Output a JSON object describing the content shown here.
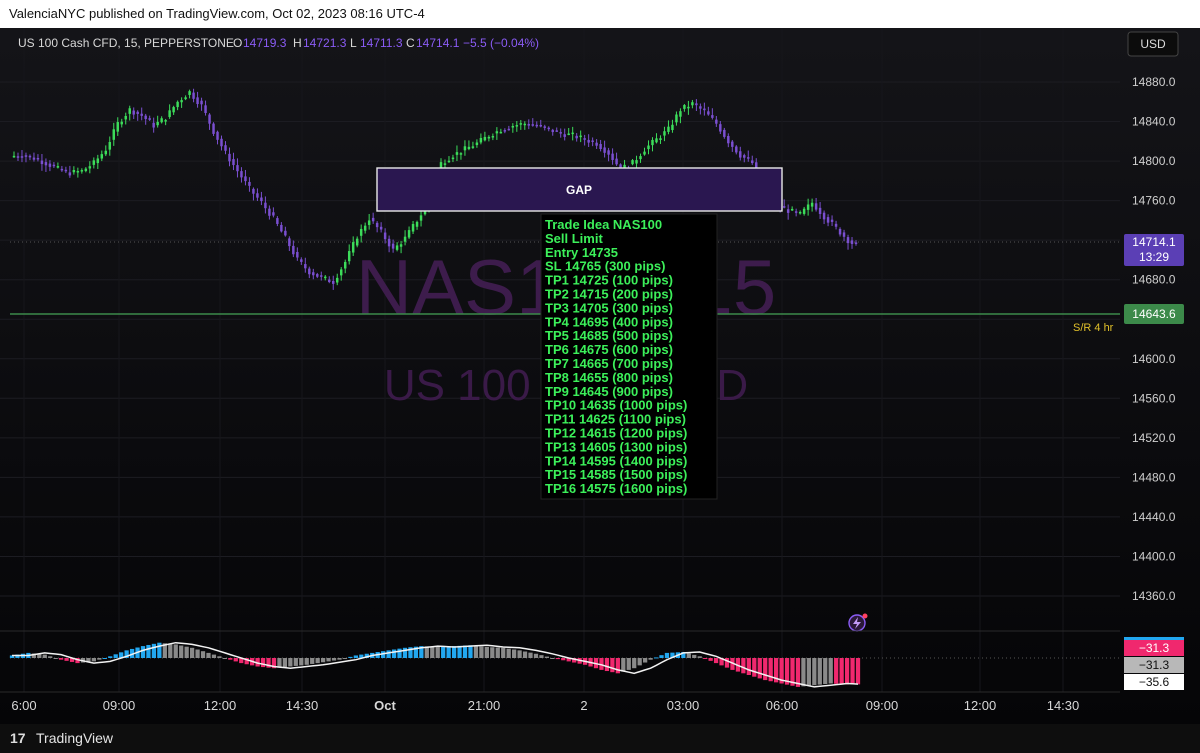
{
  "header": {
    "published": "ValenciaNYC published on TradingView.com, Oct 02, 2023 08:16 UTC-4"
  },
  "footer": {
    "brand": "TradingView",
    "logo": "17"
  },
  "symbol": {
    "name": "US 100 Cash CFD, 15, PEPPERSTONE",
    "o_label": "O",
    "o": "14719.3",
    "h_label": "H",
    "h": "14721.3",
    "l_label": "L",
    "l": "14711.3",
    "c_label": "C",
    "c": "14714.1",
    "change": "−5.5 (−0.04%)"
  },
  "currency": "USD",
  "watermark": {
    "line1": "NAS100, 15",
    "line2": "US 100 Cash CFD"
  },
  "colors": {
    "up": "#3cdc5a",
    "down": "#7a4fd0",
    "hist_blue": "#22a7f0",
    "hist_pink": "#f0286e",
    "hist_grey": "#8a8a8a",
    "sr_line": "#3c8a4a",
    "sr_label": "#e0c02a",
    "text_box": "#3cf05a"
  },
  "gap_label": "GAP",
  "sr": {
    "label": "S/R 4 hr",
    "value": "14643.6"
  },
  "price_tag": {
    "value": "14714.1",
    "timer": "13:29"
  },
  "trade_box": [
    "Trade Idea NAS100",
    "Sell Limit",
    "Entry 14735",
    "SL 14765 (300 pips)",
    "TP1 14725 (100 pips)",
    "TP2 14715 (200 pips)",
    "TP3 14705 (300 pips)",
    "TP4 14695 (400 pips)",
    "TP5 14685 (500 pips)",
    "TP6 14675 (600 pips)",
    "TP7 14665 (700 pips)",
    "TP8 14655 (800 pips)",
    "TP9 14645 (900 pips)",
    "TP10 14635 (1000 pips)",
    "TP11 14625 (1100 pips)",
    "TP12 14615 (1200 pips)",
    "TP13 14605 (1300 pips)",
    "TP14 14595 (1400 pips)",
    "TP15 14585 (1500 pips)",
    "TP16 14575 (1600 pips)"
  ],
  "osc_labels": [
    "−31.3",
    "−31.3",
    "−35.6"
  ],
  "chart_data": {
    "type": "candlestick",
    "y_ticks": [
      14880.0,
      14840.0,
      14800.0,
      14760.0,
      14720.0,
      14680.0,
      14640.0,
      14600.0,
      14560.0,
      14520.0,
      14480.0,
      14440.0,
      14400.0,
      14360.0
    ],
    "hidden_ticks": [
      14720.0,
      14640.0
    ],
    "x_ticks": [
      "6:00",
      "09:00",
      "12:00",
      "14:30",
      "Oct",
      "21:00",
      "2",
      "03:00",
      "06:00",
      "09:00",
      "12:00",
      "14:30"
    ],
    "price_series": [
      [
        0,
        14805
      ],
      [
        3,
        14806
      ],
      [
        6,
        14803
      ],
      [
        9,
        14798
      ],
      [
        12,
        14792
      ],
      [
        15,
        14788
      ],
      [
        18,
        14790
      ],
      [
        21,
        14798
      ],
      [
        24,
        14812
      ],
      [
        27,
        14838
      ],
      [
        30,
        14852
      ],
      [
        33,
        14846
      ],
      [
        36,
        14836
      ],
      [
        39,
        14844
      ],
      [
        42,
        14860
      ],
      [
        45,
        14870
      ],
      [
        48,
        14856
      ],
      [
        51,
        14830
      ],
      [
        54,
        14808
      ],
      [
        57,
        14790
      ],
      [
        60,
        14772
      ],
      [
        63,
        14758
      ],
      [
        66,
        14742
      ],
      [
        69,
        14722
      ],
      [
        72,
        14700
      ],
      [
        75,
        14688
      ],
      [
        78,
        14682
      ],
      [
        81,
        14678
      ],
      [
        84,
        14698
      ],
      [
        87,
        14724
      ],
      [
        90,
        14742
      ],
      [
        93,
        14728
      ],
      [
        96,
        14710
      ],
      [
        99,
        14722
      ],
      [
        102,
        14740
      ],
      [
        105,
        14758
      ],
      [
        108,
        14798
      ],
      [
        111,
        14806
      ],
      [
        114,
        14812
      ],
      [
        117,
        14818
      ],
      [
        120,
        14826
      ],
      [
        123,
        14832
      ],
      [
        126,
        14836
      ],
      [
        129,
        14838
      ],
      [
        132,
        14836
      ],
      [
        135,
        14832
      ],
      [
        138,
        14828
      ],
      [
        141,
        14826
      ],
      [
        144,
        14822
      ],
      [
        147,
        14818
      ],
      [
        150,
        14808
      ],
      [
        153,
        14792
      ],
      [
        156,
        14798
      ],
      [
        159,
        14812
      ],
      [
        162,
        14822
      ],
      [
        165,
        14832
      ],
      [
        168,
        14852
      ],
      [
        171,
        14858
      ],
      [
        174,
        14850
      ],
      [
        177,
        14838
      ],
      [
        180,
        14820
      ],
      [
        183,
        14806
      ],
      [
        186,
        14798
      ],
      [
        189,
        14760
      ],
      [
        192,
        14756
      ],
      [
        195,
        14750
      ],
      [
        198,
        14746
      ],
      [
        201,
        14758
      ],
      [
        204,
        14744
      ],
      [
        207,
        14732
      ],
      [
        210,
        14720
      ],
      [
        212,
        14714
      ]
    ],
    "osc_values": [
      [
        0,
        3
      ],
      [
        3,
        6
      ],
      [
        6,
        4
      ],
      [
        9,
        -2
      ],
      [
        12,
        -6
      ],
      [
        15,
        -4
      ],
      [
        18,
        2
      ],
      [
        21,
        9
      ],
      [
        24,
        14
      ],
      [
        27,
        18
      ],
      [
        30,
        16
      ],
      [
        33,
        12
      ],
      [
        36,
        6
      ],
      [
        39,
        0
      ],
      [
        42,
        -6
      ],
      [
        45,
        -10
      ],
      [
        48,
        -12
      ],
      [
        51,
        -10
      ],
      [
        54,
        -8
      ],
      [
        57,
        -5
      ],
      [
        60,
        -2
      ],
      [
        63,
        3
      ],
      [
        66,
        6
      ],
      [
        69,
        9
      ],
      [
        72,
        12
      ],
      [
        75,
        14
      ],
      [
        78,
        13
      ],
      [
        81,
        14
      ],
      [
        84,
        15
      ],
      [
        87,
        13
      ],
      [
        90,
        12
      ],
      [
        93,
        9
      ],
      [
        96,
        5
      ],
      [
        99,
        0
      ],
      [
        102,
        -4
      ],
      [
        105,
        -8
      ],
      [
        108,
        -14
      ],
      [
        111,
        -18
      ],
      [
        114,
        -12
      ],
      [
        117,
        -2
      ],
      [
        120,
        6
      ],
      [
        123,
        7
      ],
      [
        126,
        2
      ],
      [
        129,
        -6
      ],
      [
        132,
        -14
      ],
      [
        135,
        -20
      ],
      [
        138,
        -26
      ],
      [
        141,
        -30
      ],
      [
        144,
        -34
      ],
      [
        147,
        -32
      ],
      [
        150,
        -30
      ],
      [
        153,
        -31
      ],
      [
        155,
        -31
      ]
    ],
    "osc_value": -31.3
  }
}
